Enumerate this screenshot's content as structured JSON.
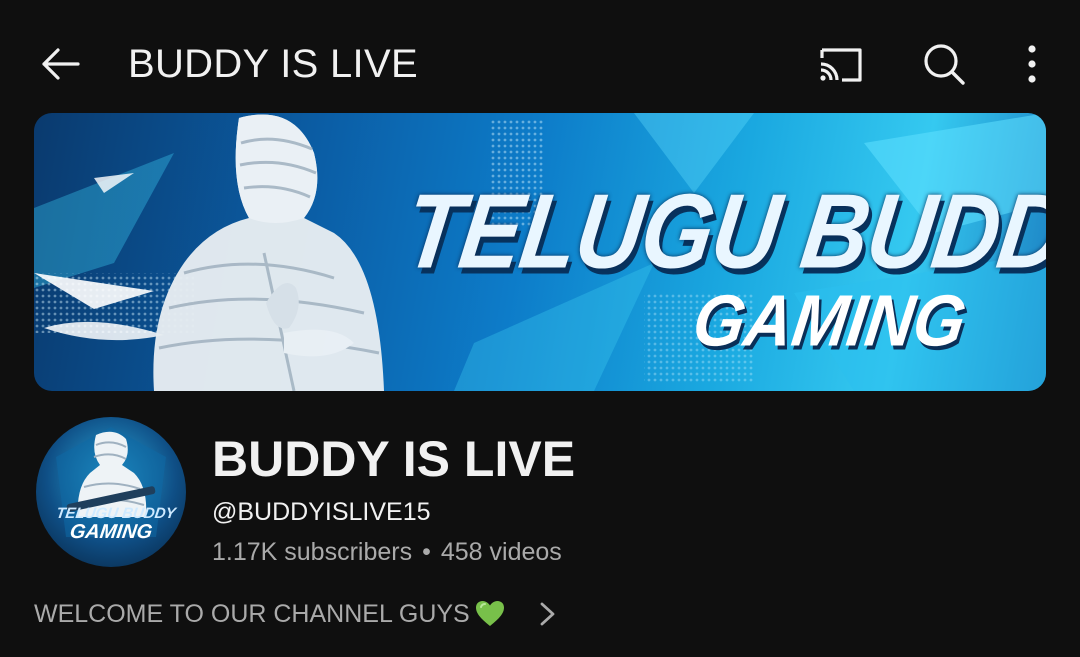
{
  "header": {
    "title": "BUDDY IS LIVE",
    "back_icon": "arrow-left-icon",
    "cast_icon": "cast-icon",
    "search_icon": "search-icon",
    "more_icon": "more-vertical-icon"
  },
  "banner": {
    "line1": "TELUGU BUDDY",
    "line2": "GAMING"
  },
  "avatar": {
    "line1": "TELUGU BUDDY",
    "line2": "GAMING"
  },
  "channel": {
    "name": "BUDDY IS LIVE",
    "handle": "@BUDDYISLIVE15",
    "subscribers": "1.17K subscribers",
    "separator": "•",
    "videos": "458 videos"
  },
  "description": {
    "text": "WELCOME TO OUR CHANNEL GUYS",
    "emoji_icon": "green-heart-icon",
    "chevron_icon": "chevron-right-icon"
  },
  "colors": {
    "background": "#0f0f0f",
    "primary_text": "#f1f1f1",
    "secondary_text": "#aaaaaa",
    "heart": "#78c04a",
    "banner_accent": "#1aa8e0"
  }
}
